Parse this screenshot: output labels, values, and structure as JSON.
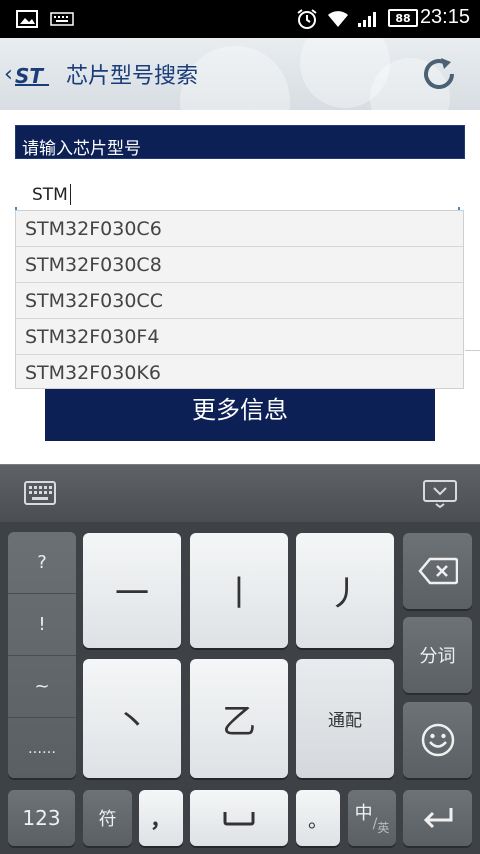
{
  "status_bar": {
    "time": "23:15",
    "battery": "88"
  },
  "header": {
    "title": "芯片型号搜索"
  },
  "form": {
    "label": "请输入芯片型号",
    "input_value": "STM"
  },
  "suggestions": [
    "STM32F030C6",
    "STM32F030C8",
    "STM32F030CC",
    "STM32F030F4",
    "STM32F030K6"
  ],
  "more_button": "更多信息",
  "keyboard": {
    "side_keys": [
      "?",
      "!",
      "~",
      "……"
    ],
    "stroke_keys": [
      "一",
      "丨",
      "丿",
      "丶",
      "乙"
    ],
    "match_key": "通配",
    "segment_key": "分词",
    "num_key": "123",
    "symbol_key": "符",
    "comma_key": "，",
    "period_key": "。",
    "lang_key": {
      "main": "中",
      "sub": "英"
    }
  }
}
